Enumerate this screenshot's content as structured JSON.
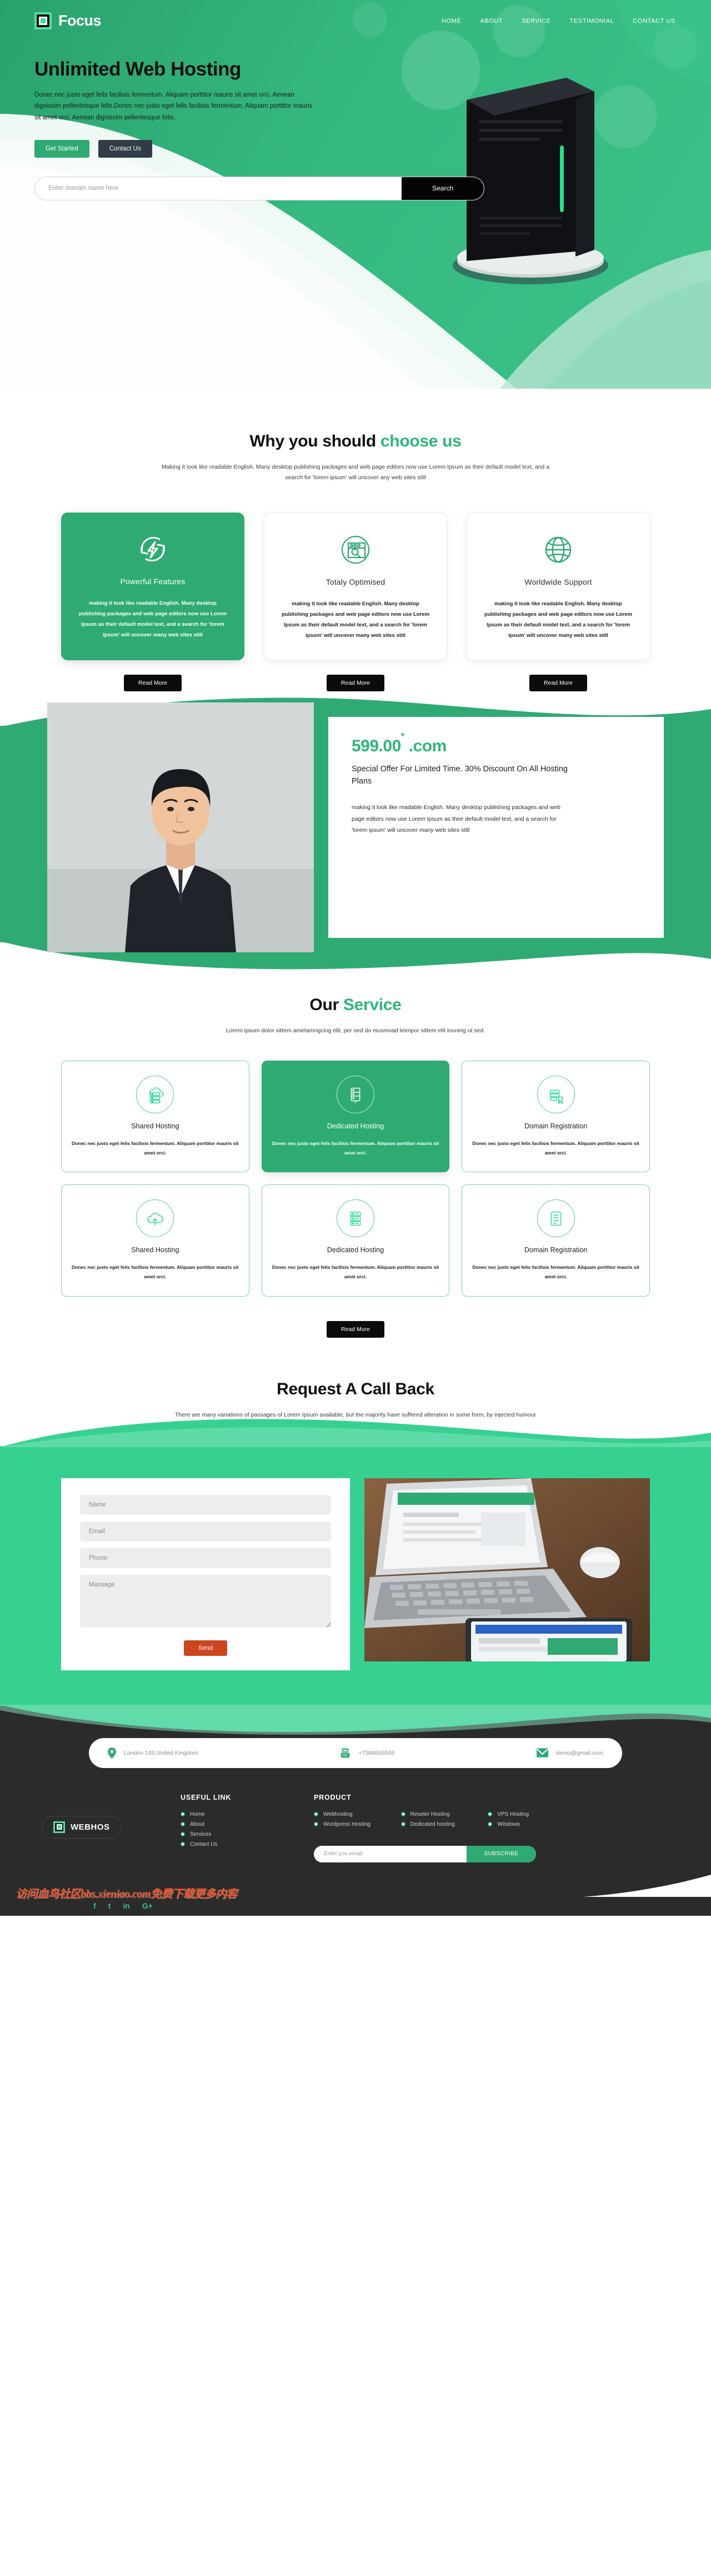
{
  "brand": {
    "name": "Focus",
    "footer_name": "WEBHOS"
  },
  "nav": {
    "items": [
      "HOME",
      "ABOUT",
      "SERVICE",
      "TESTIMONIAL",
      "CONTACT US"
    ]
  },
  "hero": {
    "title": "Unlimited Web Hosting",
    "subtitle": "Donec nec justo eget felis facilisis fermentum. Aliquam porttitor mauris sit amet orci. Aenean dignissim pellentesque felis.Donec nec justo eget felis facilisis fermentum. Aliquam porttitor mauris sit amet orci. Aenean dignissim pellentesque felis.",
    "primary_btn": "Get Started",
    "secondary_btn": "Contact Us"
  },
  "search": {
    "placeholder": "Enter domain name here",
    "button": "Search"
  },
  "why": {
    "title_plain": "Why you should ",
    "title_accent": "choose us",
    "subtitle": "Making it look like readable English. Many desktop publishing packages and web page editors now use Lorem Ipsum as their default model text, and a search for 'lorem ipsum' will uncover any web sites still",
    "body_text": "making it look like readable English. Many desktop publishing packages and web page editors now use Lorem Ipsum as their default model text, and a search for 'lorem ipsum' will uncover many web sites still",
    "read_more": "Read More",
    "cards": [
      {
        "name": "Powerful Features",
        "icon": "refresh-bolt-icon"
      },
      {
        "name": "Totaly Optimised",
        "icon": "browser-search-icon"
      },
      {
        "name": "Worldwide Support",
        "icon": "globe-icon"
      }
    ]
  },
  "offer": {
    "price": "599.00",
    "price_sup": "*",
    "price_tld": ".com",
    "headline": "Special Offer For Limited Time. 30% Discount On All Hosting Plans",
    "text": "making it look like readable English. Many desktop publishing packages and web page editors now use Lorem Ipsum as their default model text, and a search for 'lorem ipsum' will uncover many web sites still"
  },
  "service": {
    "title_plain": "Our ",
    "title_accent": "Service",
    "subtitle": "Lorem ipsum dolor sittem ametamngcing elit, per sed do eiusmoad teimpor sittem elit inuning ut sed.",
    "read_more": "Read More",
    "card_text": "Donec nec justo eget felis facilisis fermentum. Aliquam porttitor mauris sit amet orci.",
    "cards": [
      {
        "name": "Shared Hosting",
        "icon": "cloud-server-icon",
        "filled": false
      },
      {
        "name": "Dedicated Hosting",
        "icon": "server-lock-icon",
        "filled": true
      },
      {
        "name": "Domain Registration",
        "icon": "domain-cart-icon",
        "filled": false
      },
      {
        "name": "Shared Hosting",
        "icon": "cloud-server-icon",
        "filled": false
      },
      {
        "name": "Dedicated Hosting",
        "icon": "server-rack-icon",
        "filled": false
      },
      {
        "name": "Domain Registration",
        "icon": "domain-list-icon",
        "filled": false
      }
    ]
  },
  "callback": {
    "title": "Request A Call Back",
    "subtitle": "There are many variations of passages of Lorem Ipsum available, but the majority have suffered alteration in some form, by injected humour",
    "form": {
      "name_placeholder": "Name",
      "email_placeholder": "Email",
      "phone_placeholder": "Phone",
      "message_placeholder": "Massage",
      "send_label": "Send"
    }
  },
  "contact_bar": {
    "address": "London 145 United Kingdom",
    "phone": "+7586656566",
    "email": "demo@gmail.com"
  },
  "footer": {
    "useful_link_title": "USEFUL LINK",
    "useful_links": [
      "Home",
      "About",
      "Services",
      "Contact Us"
    ],
    "product_title": "PRODUCT",
    "products": [
      "Webhosting",
      "Reseler Hosting",
      "VPS Hosting",
      "Wordpress Hosting",
      "Dedicated hosting",
      "Windows"
    ],
    "subscribe": {
      "placeholder": "Enter you email",
      "button": "SUBSCRIBE"
    },
    "socials": [
      "f",
      "t",
      "in",
      "G+"
    ],
    "watermark": "访问血鸟社区bbs.xieniao.com免费下载更多内容"
  },
  "colors": {
    "green": "#2eaa72",
    "green_light": "#36d191",
    "accent": "#2eb67a",
    "dark": "#2b2b2b",
    "send_red": "#cc4520"
  }
}
